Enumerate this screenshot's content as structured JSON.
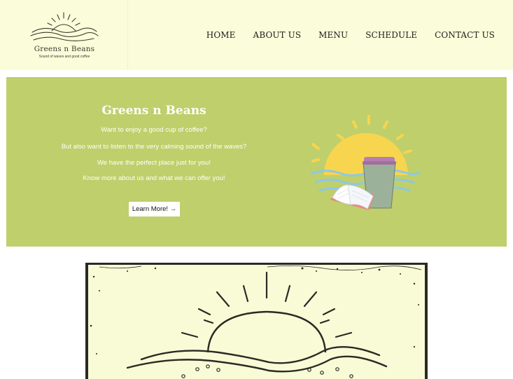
{
  "brand": {
    "name": "Greens n Beans",
    "tagline": "Sound of waves and good coffee"
  },
  "nav": {
    "items": [
      "HOME",
      "ABOUT US",
      "MENU",
      "SCHEDULE",
      "CONTACT US"
    ]
  },
  "hero": {
    "title": "Greens n Beans",
    "lines": [
      "Want to enjoy a good cup of coffee?",
      "But also want to listen to the very calming sound of the waves?",
      "We have the perfect place just for you!",
      "Know more about us and what we can offer you!"
    ],
    "button_label": "Learn More! →"
  },
  "colors": {
    "header_bg": "#fbfcd9",
    "hero_bg": "#bfcf6b",
    "sun": "#f7d54e",
    "cup": "#9bb19a",
    "lid": "#b57fb0",
    "water": "#8fc7e6"
  },
  "icons": {
    "logo": "sun-over-waves-icon",
    "hero": "coffee-cup-book-sun-illustration",
    "sketch": "sun-over-waves-sketch"
  }
}
